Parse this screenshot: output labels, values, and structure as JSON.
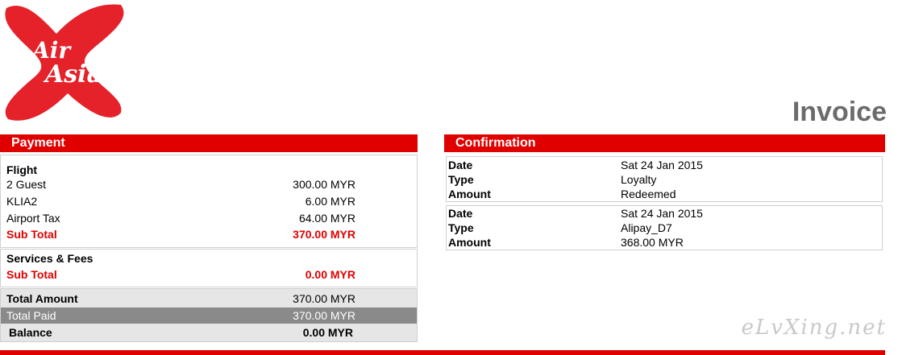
{
  "brand": {
    "logo_text_line1": "Air",
    "logo_text_line2": "Asia",
    "brand_color": "#e00000"
  },
  "title": "Invoice",
  "payment": {
    "header": "Payment",
    "flight": {
      "heading": "Flight",
      "items": [
        {
          "label": "2 Guest",
          "amount": "300.00 MYR"
        },
        {
          "label": "KLIA2",
          "amount": "6.00 MYR"
        },
        {
          "label": "Airport Tax",
          "amount": "64.00 MYR"
        }
      ],
      "subtotal_label": "Sub Total",
      "subtotal_amount": "370.00 MYR"
    },
    "services": {
      "heading": "Services & Fees",
      "subtotal_label": "Sub Total",
      "subtotal_amount": "0.00 MYR"
    },
    "totals": {
      "total_amount_label": "Total Amount",
      "total_amount": "370.00 MYR",
      "total_paid_label": "Total Paid",
      "total_paid": "370.00 MYR",
      "balance_label": "Balance",
      "balance": "0.00 MYR"
    }
  },
  "confirmation": {
    "header": "Confirmation",
    "entries": [
      {
        "date_label": "Date",
        "date": "Sat 24 Jan 2015",
        "type_label": "Type",
        "type": "Loyalty",
        "amount_label": "Amount",
        "amount": "Redeemed"
      },
      {
        "date_label": "Date",
        "date": "Sat 24 Jan 2015",
        "type_label": "Type",
        "type": "Alipay_D7",
        "amount_label": "Amount",
        "amount": "368.00 MYR"
      }
    ]
  },
  "watermark": "eLvXing.net"
}
